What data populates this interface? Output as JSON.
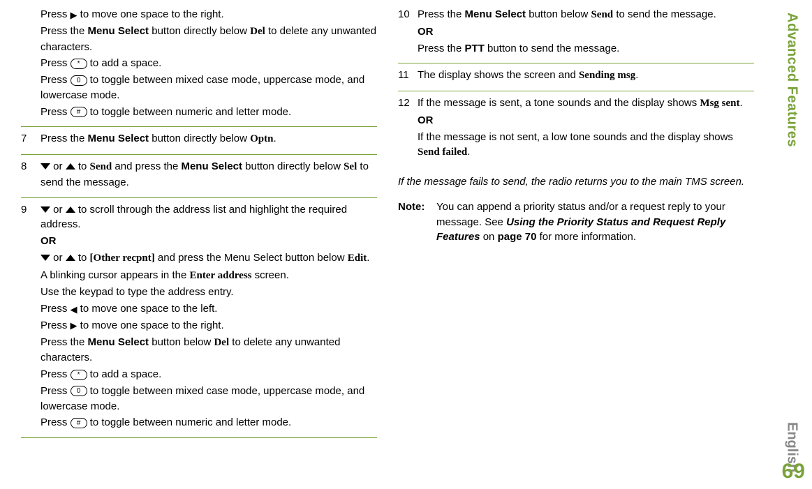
{
  "sidebar": {
    "section": "Advanced Features",
    "language": "English"
  },
  "page_number": "69",
  "col1": {
    "step6": {
      "l1a": "Press ",
      "l1b": " to move one space to the right.",
      "l2a": "Press the ",
      "l2b": "Menu Select",
      "l2c": " button directly below ",
      "l2d": "Del",
      "l2e": " to delete any unwanted characters.",
      "l3a": "Press ",
      "l3b": " to add a space.",
      "l4a": "Press ",
      "l4b": " to toggle between mixed case mode, uppercase mode, and lowercase mode.",
      "l5a": "Press ",
      "l5b": " to toggle between numeric and letter mode."
    },
    "step7": {
      "num": "7",
      "a": "Press the ",
      "b": "Menu Select",
      "c": " button directly below ",
      "d": "Optn",
      "e": "."
    },
    "step8": {
      "num": "8",
      "a": " or ",
      "b": " to ",
      "c": "Send",
      "d": " and press the ",
      "e": "Menu Select",
      "f": " button directly below ",
      "g": "Sel",
      "h": " to send the message."
    },
    "step9": {
      "num": "9",
      "l1a": " or ",
      "l1b": " to scroll through the address list and highlight the required address.",
      "or": "OR",
      "l2a": " or ",
      "l2b": " to ",
      "l2c": "[Other recpnt]",
      "l2d": " and press the Menu Select button below ",
      "l2e": "Edit",
      "l2f": ".",
      "l3a": "A blinking cursor appears in the ",
      "l3b": "Enter address",
      "l3c": " screen.",
      "l4": "Use the keypad to type the address entry.",
      "l5a": "Press ",
      "l5b": " to move one space to the left.",
      "l6a": "Press ",
      "l6b": " to move one space to the right.",
      "l7a": "Press the ",
      "l7b": "Menu Select",
      "l7c": " button below ",
      "l7d": "Del",
      "l7e": " to delete any unwanted characters.",
      "l8a": "Press ",
      "l8b": " to add a space.",
      "l9a": "Press ",
      "l9b": " to toggle between mixed case mode, uppercase mode, and lowercase mode.",
      "l10a": "Press ",
      "l10b": " to toggle between numeric and letter mode."
    }
  },
  "col2": {
    "step10": {
      "num": "10",
      "l1a": "Press the ",
      "l1b": "Menu Select",
      "l1c": " button below ",
      "l1d": "Send",
      "l1e": " to send the message.",
      "or": "OR",
      "l2a": "Press the ",
      "l2b": "PTT",
      "l2c": " button to send the message."
    },
    "step11": {
      "num": "11",
      "a": "The display shows the screen and ",
      "b": "Sending msg",
      "c": "."
    },
    "step12": {
      "num": "12",
      "l1a": "If the message is sent, a tone sounds and the display shows ",
      "l1b": "Msg sent",
      "l1c": ".",
      "or": "OR",
      "l2a": "If the message is not sent, a low tone sounds and the display shows ",
      "l2b": "Send failed",
      "l2c": "."
    },
    "after": "If the message fails to send, the radio returns you to the main TMS screen.",
    "note": {
      "label": "Note:",
      "a": "You can append a priority status and/or a request reply to your message. See ",
      "b": "Using the Priority Status and Request Reply Features",
      "c": " on ",
      "d": "page 70",
      "e": " for more information."
    }
  },
  "keys": {
    "star": "*",
    "zero": "0",
    "hash": "#"
  }
}
